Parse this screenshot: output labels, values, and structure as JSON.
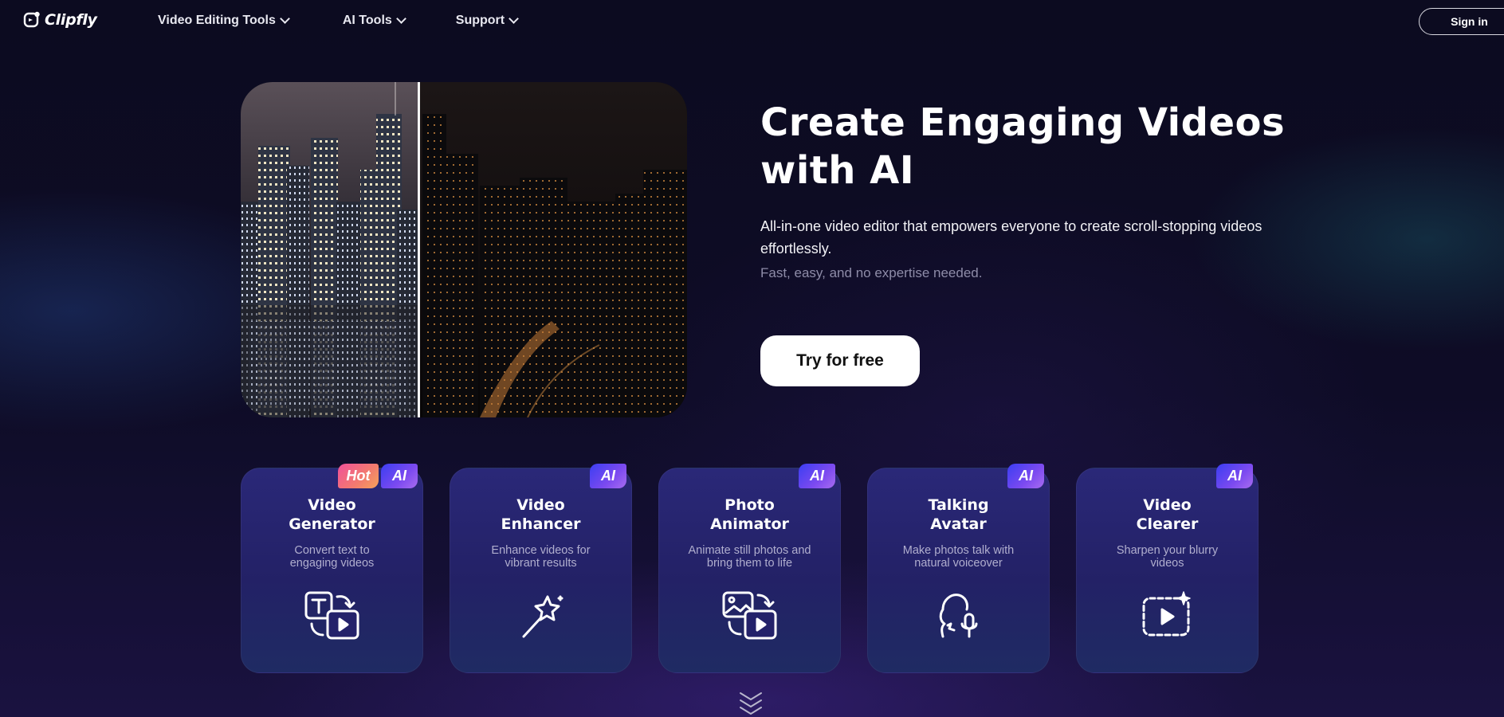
{
  "brand": {
    "name": "Clipfly"
  },
  "nav": {
    "items": [
      {
        "label": "Video Editing Tools"
      },
      {
        "label": "AI Tools"
      },
      {
        "label": "Support"
      }
    ]
  },
  "header": {
    "signin_label": "Sign in"
  },
  "hero": {
    "title_line1": "Create Engaging Videos",
    "title_line2": "with AI",
    "subtitle": "All-in-one video editor that empowers everyone to create scroll-stopping videos effortlessly.",
    "note": "Fast, easy, and no expertise needed.",
    "cta_label": "Try for free"
  },
  "badges": {
    "hot": "Hot",
    "ai": "AI"
  },
  "cards": [
    {
      "title_line1": "Video",
      "title_line2": "Generator",
      "desc_line1": "Convert text to",
      "desc_line2": "engaging videos",
      "icon": "text-to-video-icon",
      "badges": [
        "Hot",
        "AI"
      ]
    },
    {
      "title_line1": "Video",
      "title_line2": "Enhancer",
      "desc_line1": "Enhance videos for",
      "desc_line2": "vibrant results",
      "icon": "magic-wand-icon",
      "badges": [
        "AI"
      ]
    },
    {
      "title_line1": "Photo",
      "title_line2": "Animator",
      "desc_line1": "Animate still photos and",
      "desc_line2": "bring them to life",
      "icon": "photo-to-video-icon",
      "badges": [
        "AI"
      ]
    },
    {
      "title_line1": "Talking",
      "title_line2": "Avatar",
      "desc_line1": "Make photos talk with",
      "desc_line2": "natural voiceover",
      "icon": "talking-head-microphone-icon",
      "badges": [
        "AI"
      ]
    },
    {
      "title_line1": "Video",
      "title_line2": "Clearer",
      "desc_line1": "Sharpen your blurry",
      "desc_line2": "videos",
      "icon": "sparkle-video-icon",
      "badges": [
        "AI"
      ]
    }
  ],
  "colors": {
    "background": "#0b0a1f",
    "card": "#26246e",
    "badge_ai": "#5b45f0",
    "badge_hot": "#f2658a",
    "cta_bg": "#ffffff"
  }
}
